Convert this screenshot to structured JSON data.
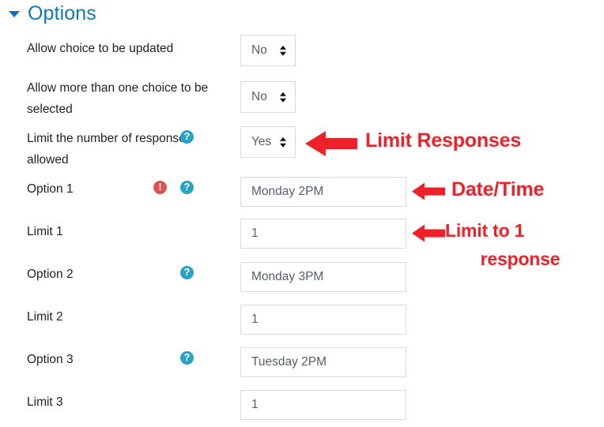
{
  "section": {
    "title": "Options",
    "caret_icon": "triangle-down-icon"
  },
  "form": {
    "rows": [
      {
        "key": "allow_update",
        "label": "Allow choice to be updated",
        "control": "select",
        "value": "No",
        "has_help": false,
        "has_error": false
      },
      {
        "key": "allow_multiple",
        "label": "Allow more than one choice to be selected",
        "control": "select",
        "value": "No",
        "has_help": false,
        "has_error": false
      },
      {
        "key": "limit_responses",
        "label": "Limit the number of responses allowed",
        "control": "select",
        "value": "Yes",
        "has_help": true,
        "has_error": false
      },
      {
        "key": "option_1",
        "label": "Option 1",
        "control": "text",
        "value": "Monday 2PM",
        "has_help": true,
        "has_error": true
      },
      {
        "key": "limit_1",
        "label": "Limit 1",
        "control": "text",
        "value": "1",
        "has_help": false,
        "has_error": false
      },
      {
        "key": "option_2",
        "label": "Option 2",
        "control": "text",
        "value": "Monday 3PM",
        "has_help": true,
        "has_error": false
      },
      {
        "key": "limit_2",
        "label": "Limit 2",
        "control": "text",
        "value": "1",
        "has_help": false,
        "has_error": false
      },
      {
        "key": "option_3",
        "label": "Option 3",
        "control": "text",
        "value": "Tuesday 2PM",
        "has_help": true,
        "has_error": false
      },
      {
        "key": "limit_3",
        "label": "Limit 3",
        "control": "text",
        "value": "1",
        "has_help": false,
        "has_error": false
      }
    ]
  },
  "icons": {
    "help_glyph": "?",
    "error_glyph": "!"
  },
  "annotations": [
    {
      "key": "limit_responses",
      "text": "Limit Responses"
    },
    {
      "key": "date_time",
      "text": "Date/Time"
    },
    {
      "key": "limit_one",
      "line1": "Limit to 1",
      "line2": "response"
    }
  ],
  "colors": {
    "section_title": "#1177b5",
    "annotation_red": "#ef2027",
    "help_icon": "#29a2c6",
    "error_icon": "#d9534f",
    "input_border": "#d7dade",
    "label_text": "#1d2125",
    "value_text": "#55606b"
  }
}
